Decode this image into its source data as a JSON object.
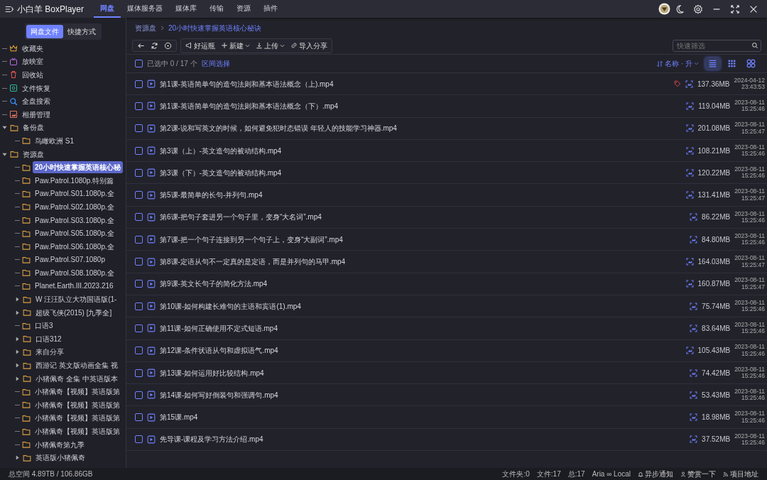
{
  "app": {
    "title": "小白羊 BoxPlayer"
  },
  "nav_tabs": [
    {
      "label": "网盘",
      "selected": true
    },
    {
      "label": "媒体服务器",
      "selected": false
    },
    {
      "label": "媒体库",
      "selected": false
    },
    {
      "label": "传输",
      "selected": false
    },
    {
      "label": "资源",
      "selected": false
    },
    {
      "label": "插件",
      "selected": false
    }
  ],
  "sidebar": {
    "tabs": [
      {
        "label": "网盘文件",
        "selected": true
      },
      {
        "label": "快捷方式",
        "selected": false
      }
    ],
    "tree": [
      {
        "label": "收藏夹",
        "kind": "favorites",
        "selected": false
      },
      {
        "label": "放映室",
        "kind": "cinema",
        "selected": false
      },
      {
        "label": "回收站",
        "kind": "trash",
        "selected": false
      },
      {
        "label": "文件恢复",
        "kind": "recover",
        "selected": false
      },
      {
        "label": "全盘搜索",
        "kind": "search",
        "selected": false
      },
      {
        "label": "相册管理",
        "kind": "album",
        "selected": false
      },
      {
        "label": "备份盘",
        "kind": "folder",
        "selected": false,
        "expanded": true,
        "children": [
          {
            "label": "鸟瞰欧洲 S1",
            "kind": "folder",
            "selected": false
          }
        ]
      },
      {
        "label": "资源盘",
        "kind": "folder",
        "selected": false,
        "expanded": true,
        "children": [
          {
            "label": "20小时快速掌握英语核心秘",
            "kind": "folder",
            "selected": true
          },
          {
            "label": "Paw.Patrol.1080p.特别篇",
            "kind": "folder",
            "selected": false
          },
          {
            "label": "Paw.Patrol.S01.1080p.全",
            "kind": "folder",
            "selected": false
          },
          {
            "label": "Paw.Patrol.S02.1080p.全",
            "kind": "folder",
            "selected": false
          },
          {
            "label": "Paw.Patrol.S03.1080p.全",
            "kind": "folder",
            "selected": false
          },
          {
            "label": "Paw.Patrol.S05.1080p.全",
            "kind": "folder",
            "selected": false
          },
          {
            "label": "Paw.Patrol.S06.1080p.全",
            "kind": "folder",
            "selected": false
          },
          {
            "label": "Paw.Patrol.S07.1080p",
            "kind": "folder",
            "selected": false
          },
          {
            "label": "Paw.Patrol.S08.1080p.全",
            "kind": "folder",
            "selected": false
          },
          {
            "label": "Planet.Earth.III.2023.216",
            "kind": "folder",
            "selected": false
          },
          {
            "label": "W 汪汪队立大功国语版(1-",
            "kind": "folder",
            "selected": false,
            "expanded": false
          },
          {
            "label": "超级飞侠(2015) [九季全]",
            "kind": "folder",
            "selected": false,
            "expanded": false
          },
          {
            "label": "口语3",
            "kind": "folder",
            "selected": false
          },
          {
            "label": "口语312",
            "kind": "folder",
            "selected": false,
            "expanded": false
          },
          {
            "label": "来自分享",
            "kind": "folder",
            "selected": false,
            "expanded": false
          },
          {
            "label": "西游记 英文版动画全集 视",
            "kind": "folder",
            "selected": false,
            "expanded": false
          },
          {
            "label": "小猪佩奇 全集 中英语版本",
            "kind": "folder",
            "selected": false,
            "expanded": false
          },
          {
            "label": "小猪佩奇【视频】英语版第",
            "kind": "folder",
            "selected": false
          },
          {
            "label": "小猪佩奇【视频】英语版第",
            "kind": "folder",
            "selected": false
          },
          {
            "label": "小猪佩奇【视频】英语版第",
            "kind": "folder",
            "selected": false
          },
          {
            "label": "小猪佩奇【视频】英语版第",
            "kind": "folder",
            "selected": false
          },
          {
            "label": "小猪佩奇第九季",
            "kind": "folder",
            "selected": false
          },
          {
            "label": "英语版小猪佩奇",
            "kind": "folder",
            "selected": false,
            "expanded": false
          }
        ]
      }
    ]
  },
  "breadcrumb": [
    "资源盘",
    "20小时快速掌握英语核心秘诀"
  ],
  "toolbar": {
    "nav_buttons": [
      {
        "kind": "back"
      },
      {
        "kind": "refresh"
      },
      {
        "kind": "locate"
      }
    ],
    "actions": [
      {
        "label": "好运瓶",
        "kind": "bottle",
        "dropdown": false
      },
      {
        "label": "新建",
        "kind": "new",
        "dropdown": true
      },
      {
        "label": "上传",
        "kind": "upload",
        "dropdown": true
      },
      {
        "label": "导入分享",
        "kind": "link",
        "dropdown": false
      }
    ],
    "filter_placeholder": "快速筛选"
  },
  "selection": {
    "checked": false,
    "count": "已选中 0 / 17 个",
    "range_link": "区间选择",
    "sort": "名称 · 升"
  },
  "views": [
    {
      "kind": "list",
      "selected": true
    },
    {
      "kind": "grid",
      "selected": false
    },
    {
      "kind": "large",
      "selected": false
    }
  ],
  "files": [
    {
      "name": "第1课-英语简单句的造句法则和基本语法概念（上).mp4",
      "size": "137.36MB",
      "date": "2024-04-12",
      "time": "23:43:53",
      "tagged": true,
      "checked": false
    },
    {
      "name": "第1课-英语简单句的造句法则和基本语法概念（下）.mp4",
      "size": "119.04MB",
      "date": "2023-08-11",
      "time": "15:25:46",
      "tagged": false,
      "checked": false
    },
    {
      "name": "第2课-说和写英文的时候，如何避免犯时态错误  年轻人的技能学习神器.mp4",
      "size": "201.08MB",
      "date": "2023-08-11",
      "time": "15:25:47",
      "tagged": false,
      "checked": false
    },
    {
      "name": "第3课（上）-英文造句的被动结构.mp4",
      "size": "108.21MB",
      "date": "2023-08-11",
      "time": "15:25:46",
      "tagged": false,
      "checked": false
    },
    {
      "name": "第3课（下）-英文造句的被动结构.mp4",
      "size": "120.22MB",
      "date": "2023-08-11",
      "time": "15:25:46",
      "tagged": false,
      "checked": false
    },
    {
      "name": "第5课-最简单的长句-并列句.mp4",
      "size": "131.41MB",
      "date": "2023-08-11",
      "time": "15:25:47",
      "tagged": false,
      "checked": false
    },
    {
      "name": "第6课-把句子套进另一个句子里，变身“大名词”.mp4",
      "size": "86.22MB",
      "date": "2023-08-11",
      "time": "15:25:46",
      "tagged": false,
      "checked": false
    },
    {
      "name": "第7课-把一个句子连接到另一个句子上，变身“大副词”.mp4",
      "size": "84.80MB",
      "date": "2023-08-11",
      "time": "15:25:46",
      "tagged": false,
      "checked": false
    },
    {
      "name": "第8课-定语从句不一定真的是定语，而是并列句的马甲.mp4",
      "size": "164.03MB",
      "date": "2023-08-11",
      "time": "15:25:47",
      "tagged": false,
      "checked": false
    },
    {
      "name": "第9课-英文长句子的简化方法.mp4",
      "size": "160.87MB",
      "date": "2023-08-11",
      "time": "15:25:47",
      "tagged": false,
      "checked": false
    },
    {
      "name": "第10课-如何构建长难句的主语和宾语(1).mp4",
      "size": "75.74MB",
      "date": "2023-08-11",
      "time": "15:25:46",
      "tagged": false,
      "checked": false
    },
    {
      "name": "第11课-如何正确使用不定式短语.mp4",
      "size": "83.64MB",
      "date": "2023-08-11",
      "time": "15:25:46",
      "tagged": false,
      "checked": false
    },
    {
      "name": "第12课-条件状语从句和虚拟语气.mp4",
      "size": "105.43MB",
      "date": "2023-08-11",
      "time": "15:25:46",
      "tagged": false,
      "checked": false
    },
    {
      "name": "第13课-如何运用好比较结构.mp4",
      "size": "74.42MB",
      "date": "2023-08-11",
      "time": "15:25:46",
      "tagged": false,
      "checked": false
    },
    {
      "name": "第14课-如何写好倒装句和强调句.mp4",
      "size": "53.43MB",
      "date": "2023-08-11",
      "time": "15:25:46",
      "tagged": false,
      "checked": false
    },
    {
      "name": "第15课.mp4",
      "size": "18.98MB",
      "date": "2023-08-11",
      "time": "15:25:46",
      "tagged": false,
      "checked": false
    },
    {
      "name": "先导课-课程及学习方法介绍.mp4",
      "size": "37.52MB",
      "date": "2023-08-11",
      "time": "15:25:46",
      "tagged": false,
      "checked": false
    }
  ],
  "status_bar": {
    "space": "总空间 4.89TB / 106.86GB",
    "counts": [
      "文件夹:0",
      "文件:17",
      "总:17",
      "Aria ∞ Local"
    ],
    "links": [
      {
        "label": "异步通知",
        "kind": "bell"
      },
      {
        "label": "赞赏一下",
        "kind": "people"
      },
      {
        "label": "项目地址",
        "kind": "rss"
      }
    ]
  }
}
